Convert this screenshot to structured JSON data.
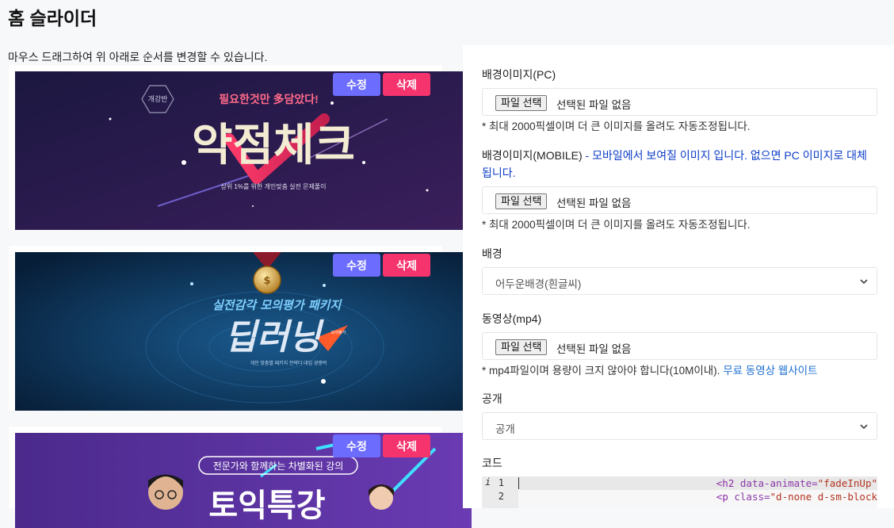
{
  "page": {
    "title": "홈 슬라이더",
    "hint": "마우스 드래그하여 위 아래로 순서를 변경할 수 있습니다."
  },
  "slides": [
    {
      "edit_label": "수정",
      "delete_label": "삭제",
      "banner": {
        "badge": "개강반",
        "tagline": "필요한것만 多담았다!",
        "headline": "약점체크",
        "subline": "상위 1%를 위한 개인맞춤 실전 문제풀이",
        "bg_from": "#1b1740",
        "bg_to": "#3a1f5e"
      }
    },
    {
      "edit_label": "수정",
      "delete_label": "삭제",
      "banner": {
        "tagline": "실전감각 모의평가 패키지",
        "headline": "딥러닝",
        "subline": "개인 맞춤별 패키지 전략더 대입 경쟁력",
        "stamp": "모의평가",
        "bg_from": "#0a2a4a",
        "bg_to": "#0f3d6b"
      }
    },
    {
      "edit_label": "수정",
      "delete_label": "삭제",
      "banner": {
        "tagline": "전문가와 함께하는 차별화된 강의",
        "headline": "토익특강",
        "bg_from": "#4a2a8a",
        "bg_to": "#6b3bb0"
      }
    }
  ],
  "form": {
    "bg_image_pc": {
      "label": "배경이미지(PC)",
      "button": "파일 선택",
      "status": "선택된 파일 없음",
      "help": "* 최대 2000픽셀이며 더 큰 이미지를 올려도 자동조정됩니다."
    },
    "bg_image_mobile": {
      "label": "배경이미지(MOBILE)",
      "note_line1": " - 모바일에서 보여질 이미지 입니다. 없으면 PC 이미지로 대체",
      "note_line2": "됩니다.",
      "button": "파일 선택",
      "status": "선택된 파일 없음",
      "help": "* 최대 2000픽셀이며 더 큰 이미지를 올려도 자동조정됩니다."
    },
    "background": {
      "label": "배경",
      "value": "어두운배경(흰글씨)"
    },
    "video": {
      "label": "동영상(mp4)",
      "button": "파일 선택",
      "status": "선택된 파일 없음",
      "help": "* mp4파일이며 용량이 크지 않아야 합니다(10M이내).",
      "help_link": "무료 동영상 웹사이트"
    },
    "visibility": {
      "label": "공개",
      "value": "공개"
    },
    "code": {
      "label": "코드",
      "line_numbers": [
        "1",
        "2"
      ],
      "gutter_marker": "i",
      "lines": [
        {
          "tag_open": "<h2 ",
          "attr": "data-animate=",
          "value": "\"fadeInUp\""
        },
        {
          "tag_open": "<p ",
          "attr": "class=",
          "value": "\"d-none d-sm-block"
        }
      ]
    }
  },
  "colors": {
    "edit_button": "#6c6cff",
    "delete_button": "#f5336d",
    "link": "#1c6fd1",
    "note_blue": "#0b3cc7"
  }
}
